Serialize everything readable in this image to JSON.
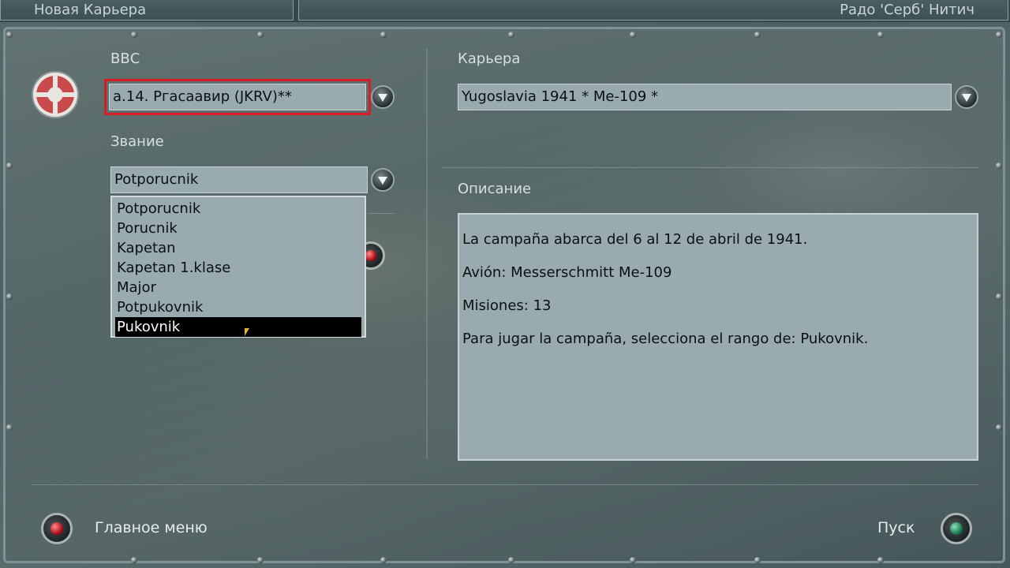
{
  "titlebar": {
    "left_title": "Новая Карьера",
    "pilot_name": "Радо 'Серб' Нитич"
  },
  "airforce": {
    "label": "ВВС",
    "value": "a.14. Pгасаавир (JKRV)**",
    "icon": "roundel-icon"
  },
  "rank": {
    "label": "Звание",
    "value": "Potporucnik",
    "options": [
      "Potporucnik",
      "Porucnik",
      "Kapetan",
      "Kapetan 1.klase",
      "Major",
      "Potpukovnik",
      "Pukovnik"
    ],
    "highlighted": "Pukovnik"
  },
  "career": {
    "label": "Карьера",
    "value": "Yugoslavia 1941 * Me-109 *"
  },
  "description": {
    "label": "Описание",
    "lines": [
      "La campaña abarca del 6 al 12 de abril de 1941.",
      "Avión: Messerschmitt Me-109",
      "Misiones: 13",
      "Para jugar la campaña, selecciona el rango de: Pukovnik."
    ]
  },
  "footer": {
    "main_menu_label": "Главное меню",
    "start_label": "Пуск"
  },
  "colors": {
    "field_bg": "#9aabb0",
    "highlight_outline": "#d91c26",
    "selected_item_bg": "#000000"
  }
}
